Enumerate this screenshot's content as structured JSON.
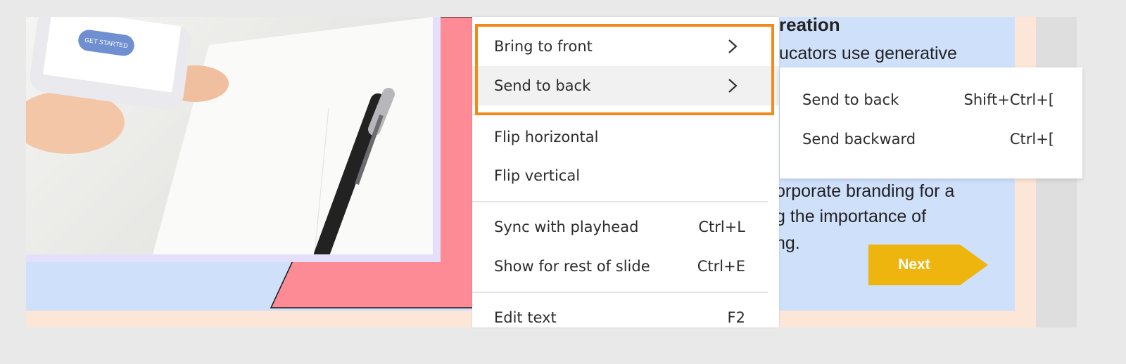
{
  "colors": {
    "page_bg": "#e9e9e9",
    "slide_bg": "#cfe0fb",
    "accent_pink": "#fd8b95",
    "menu_highlight": "#f2891a",
    "next_button": "#eeb50f"
  },
  "phone": {
    "button_label": "GET STARTED"
  },
  "slide": {
    "heading": "reation",
    "line1": "ucators use generative",
    "line2": "orporate branding for a",
    "line3": "g the importance of",
    "line4": "ng.",
    "next_label": "Next"
  },
  "context_menu": {
    "bring_to_front": "Bring to front",
    "send_to_back": "Send to back",
    "flip_horizontal": "Flip horizontal",
    "flip_vertical": "Flip vertical",
    "sync_with_playhead": "Sync with playhead",
    "sync_shortcut": "Ctrl+L",
    "show_rest": "Show for rest of slide",
    "show_rest_shortcut": "Ctrl+E",
    "edit_text": "Edit text",
    "edit_text_shortcut": "F2"
  },
  "submenu": {
    "send_to_back": "Send to back",
    "send_to_back_shortcut": "Shift+Ctrl+[",
    "send_backward": "Send backward",
    "send_backward_shortcut": "Ctrl+["
  }
}
